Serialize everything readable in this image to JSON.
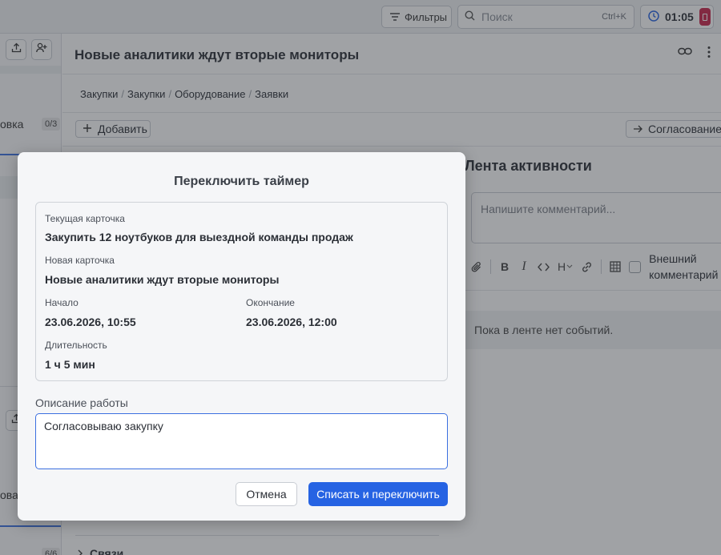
{
  "topbar": {
    "filters_label": "Фильтры",
    "search_placeholder": "Поиск",
    "search_shortcut": "Ctrl+K",
    "timer_value": "01:05"
  },
  "left_panel": {
    "item1_text": "овка",
    "item1_count": "0/3",
    "item2_text": "ова",
    "item3_count": "6/6"
  },
  "card": {
    "title": "Новые аналитики ждут вторые мониторы",
    "breadcrumbs": [
      "Закупки",
      "Закупки",
      "Оборудование",
      "Заявки"
    ],
    "add_label": "Добавить",
    "approval_label": "Согласование б",
    "links_label": "Связи"
  },
  "activity": {
    "title": "Лента активности",
    "comment_placeholder": "Напишите комментарий...",
    "external_label_1": "Внешний",
    "external_label_2": "комментарий",
    "empty_text": "Пока в ленте нет событий."
  },
  "modal": {
    "title": "Переключить таймер",
    "current_label": "Текущая карточка",
    "current_value": "Закупить 12 ноутбуков для выездной команды продаж",
    "new_label": "Новая карточка",
    "new_value": "Новые аналитики ждут вторые мониторы",
    "start_label": "Начало",
    "start_value": "23.06.2026, 10:55",
    "end_label": "Окончание",
    "end_value": "23.06.2026, 12:00",
    "duration_label": "Длительность",
    "duration_value": "1 ч 5 мин",
    "description_label": "Описание работы",
    "description_value": "Согласовываю закупку",
    "cancel_label": "Отмена",
    "confirm_label": "Списать и переключить"
  },
  "colors": {
    "accent": "#2663e3",
    "stop": "#c8254b"
  }
}
